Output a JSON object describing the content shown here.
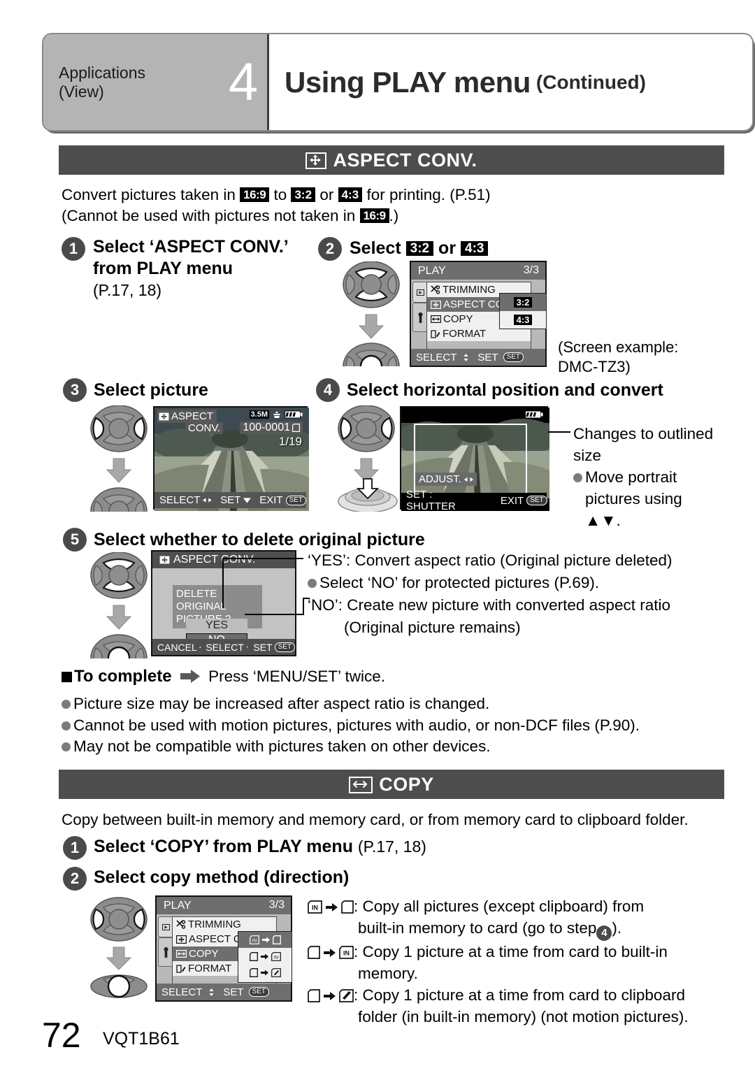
{
  "header": {
    "category": "Applications",
    "category2": "(View)",
    "chapter_number": "4",
    "title": "Using PLAY menu",
    "title_suffix": "(Continued)"
  },
  "aspect_section": {
    "bar_label": "ASPECT CONV.",
    "bar_icon": "four-way-arrow-icon",
    "intro_line1_a": "Convert pictures taken in",
    "intro_tag_169": "16:9",
    "intro_line1_b": "to",
    "intro_tag_32": "3:2",
    "intro_line1_c": "or",
    "intro_tag_43": "4:3",
    "intro_line1_d": "for printing. (P.51)",
    "intro_line2_a": "(Cannot be used with pictures not taken in",
    "intro_line2_tag": "16:9",
    "intro_line2_b": ".)",
    "step1": {
      "num": "1",
      "line1": "Select ‘ASPECT CONV.’",
      "line2": "from PLAY menu",
      "line3": "(P.17, 18)"
    },
    "step2": {
      "num": "2",
      "label_a": "Select",
      "tag_32": "3:2",
      "label_b": "or",
      "tag_43": "4:3",
      "screen": {
        "title": "PLAY",
        "page": "3/3",
        "rows": [
          "TRIMMING",
          "ASPECT CONV.",
          "COPY",
          "FORMAT"
        ],
        "option_32": "3:2",
        "option_43": "4:3",
        "footer_select": "SELECT",
        "footer_set": "SET",
        "footer_badge": "MENU SET"
      },
      "caption_line1": "(Screen example:",
      "caption_line2": "DMC-TZ3)"
    },
    "step3": {
      "num": "3",
      "title": "Select picture",
      "screen": {
        "label_line1": "ASPECT",
        "label_line2": "CONV.",
        "size_tag": "3.5M",
        "file_no": "100-0001",
        "counter": "1/19",
        "footer_select": "SELECT",
        "footer_set": "SET",
        "footer_exit": "EXIT",
        "footer_badge": "MENU SET"
      }
    },
    "step4": {
      "num": "4",
      "title": "Select horizontal position and convert",
      "screen": {
        "adjust": "ADJUST.",
        "footer_set": "SET : SHUTTER",
        "footer_exit": "EXIT",
        "footer_badge": "MENU SET"
      },
      "note_line1": "Changes to outlined",
      "note_line2": "size",
      "note_bullet_line1": "Move portrait",
      "note_bullet_line2": "pictures using",
      "note_bullet_line3": "▲▼."
    },
    "step5": {
      "num": "5",
      "title": "Select whether to delete original picture",
      "screen": {
        "title": "ASPECT CONV.",
        "prompt_line1": "DELETE ORIGINAL",
        "prompt_line2": "PICTURE ?",
        "yes": "YES",
        "no": "NO",
        "footer_cancel": "CANCEL",
        "footer_select": "SELECT",
        "footer_set": "SET",
        "footer_badge": "MENU SET"
      },
      "note_yes": "‘YES’: Convert aspect ratio (Original picture deleted)",
      "note_bullet": "Select ‘NO’ for protected pictures (P.69).",
      "note_no_line1": "‘NO’: Create new picture with converted aspect ratio",
      "note_no_line2": "(Original picture remains)"
    },
    "complete": {
      "label": "To complete",
      "text": "Press ‘MENU/SET’ twice."
    },
    "bullets": [
      "Picture size may be increased after aspect ratio is changed.",
      "Cannot be used with motion pictures, pictures with audio, or non-DCF files (P.90).",
      "May not be compatible with pictures taken on other devices."
    ]
  },
  "copy_section": {
    "bar_label": "COPY",
    "bar_icon": "double-arrow-box-icon",
    "intro": "Copy between built-in memory and memory card, or from memory card to clipboard folder.",
    "step1": {
      "num": "1",
      "label_bold": "Select ‘COPY’ from PLAY menu",
      "label_ref": "(P.17, 18)"
    },
    "step2": {
      "num": "2",
      "label": "Select copy method (direction)",
      "screen": {
        "title": "PLAY",
        "page": "3/3",
        "rows": [
          "TRIMMING",
          "ASPECT CONV.",
          "COPY",
          "FORMAT"
        ],
        "footer_select": "SELECT",
        "footer_set": "SET",
        "footer_badge": "MENU SET"
      }
    },
    "methods": [
      {
        "from_icon": "built-in-memory-icon",
        "to_icon": "card-icon",
        "line1": ": Copy all pictures (except clipboard) from",
        "line2_a": "built-in memory to card (go to step",
        "line2_step": "4",
        "line2_b": ")."
      },
      {
        "from_icon": "card-icon",
        "to_icon": "built-in-memory-icon",
        "line1": ": Copy 1 picture at a time from card to built-in",
        "line2_a": "memory.",
        "line2_step": "",
        "line2_b": ""
      },
      {
        "from_icon": "card-icon",
        "to_icon": "clipboard-icon",
        "line1": ": Copy 1 picture at a time from card to clipboard",
        "line2_a": "folder (in built-in memory) (not motion pictures).",
        "line2_step": "",
        "line2_b": ""
      }
    ]
  },
  "footer": {
    "page_number": "72",
    "doc_code": "VQT1B61"
  },
  "colors": {
    "bar_dark": "#4d4d4d",
    "header_gray": "#b4b4b4",
    "step_circle": "#4a4a4a",
    "bullet_gray": "#7b7b7b"
  }
}
